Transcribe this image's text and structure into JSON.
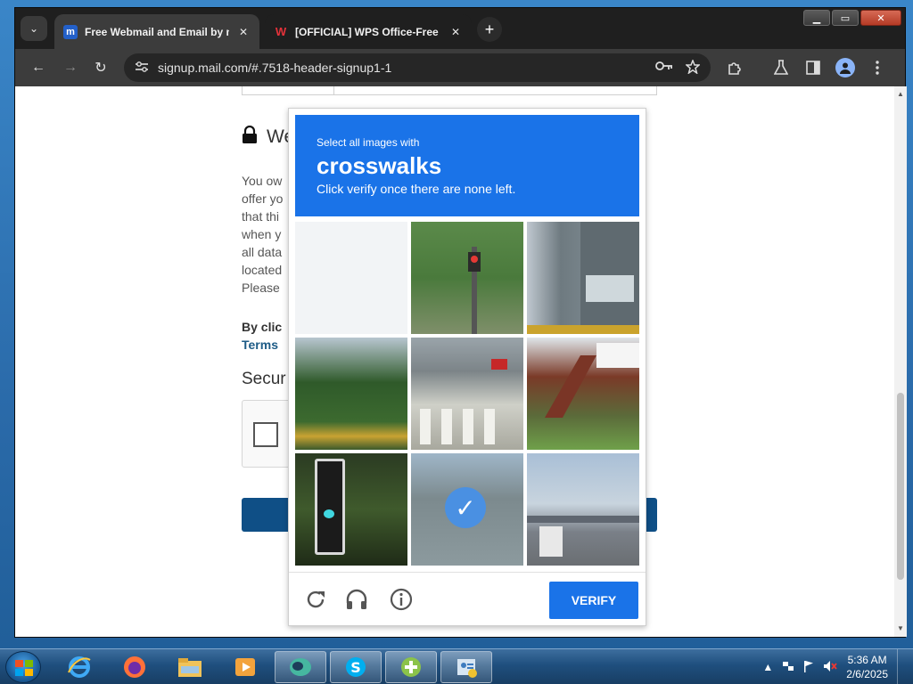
{
  "browser": {
    "tabs": [
      {
        "title": "Free Webmail and Email by ma",
        "favicon": "mail-com-logo",
        "active": true
      },
      {
        "title": "[OFFICIAL] WPS Office-Free Of",
        "favicon": "wps-logo",
        "active": false
      }
    ],
    "favicon_letters": {
      "mail": "m",
      "wps": "W"
    },
    "url": "signup.mail.com/#.7518-header-signup1-1",
    "icons": {
      "back": "←",
      "forward": "→",
      "reload": "↻",
      "new_tab": "+",
      "tab_close": "✕",
      "tab_search": "⌄"
    },
    "window_controls": {
      "minimize": "▁",
      "maximize": "▭",
      "close": "✕"
    }
  },
  "page": {
    "section_title": "We",
    "paragraph_lines": [
      "You ow",
      "offer yo",
      "that thi",
      "when y",
      "all data",
      "located",
      "Please"
    ],
    "consent_line": "By clic",
    "terms_link": "Terms",
    "security_heading": "Secur"
  },
  "challenge": {
    "prompt_small": "Select all images with",
    "prompt_keyword": "crosswalks",
    "prompt_hint": "Click verify once there are none left.",
    "verify_label": "VERIFY",
    "selected_tile_index": 7,
    "footer_icons": [
      "reload-icon",
      "audio-challenge-icon",
      "info-icon"
    ]
  },
  "taskbar": {
    "time": "5:36 AM",
    "date": "2/6/2025",
    "apps": [
      "internet-explorer-icon",
      "firefox-icon",
      "file-explorer-icon",
      "media-player-icon",
      "chrome-like-icon",
      "skype-icon",
      "add-app-icon",
      "contacts-icon"
    ]
  },
  "colors": {
    "accent_blue": "#1a73e8",
    "submit_blue": "#0f4f86",
    "terms_link": "#1d5b86"
  }
}
